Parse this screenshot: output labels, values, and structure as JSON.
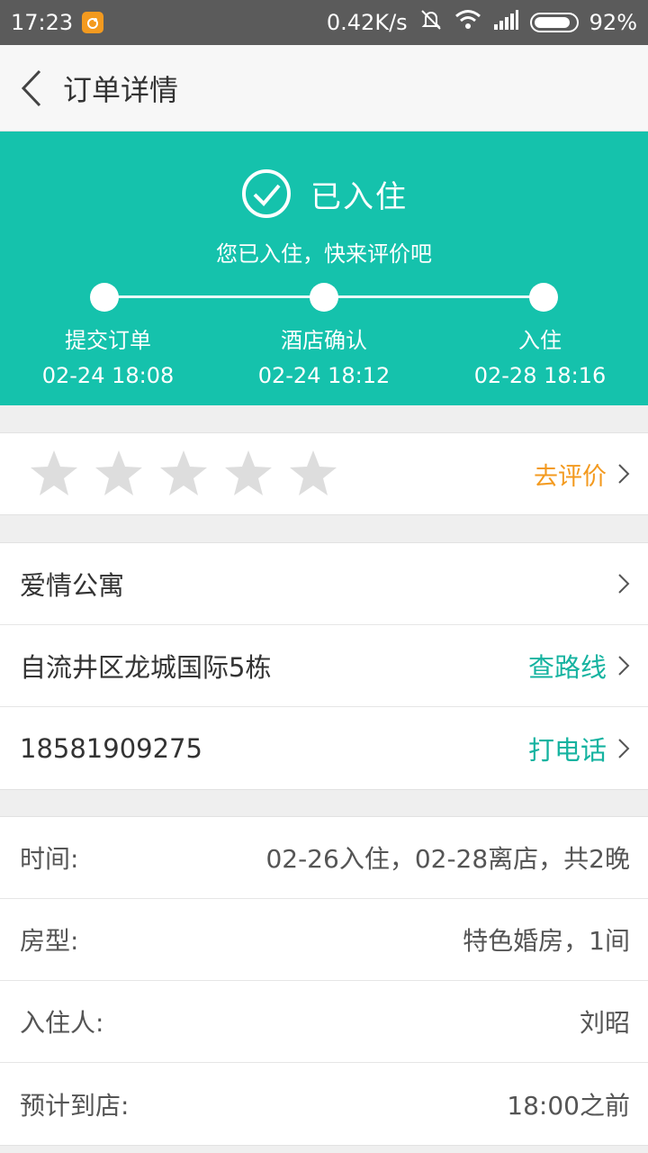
{
  "status_bar": {
    "time": "17:23",
    "network_speed": "0.42K/s",
    "battery": "92%",
    "icons": [
      "uc-browser-icon",
      "silent-icon",
      "wifi-icon",
      "signal-icon",
      "battery-icon"
    ]
  },
  "header": {
    "title": "订单详情"
  },
  "order_status": {
    "title": "已入住",
    "subtitle": "您已入住，快来评价吧",
    "steps": [
      {
        "label": "提交订单",
        "time": "02-24 18:08"
      },
      {
        "label": "酒店确认",
        "time": "02-24 18:12"
      },
      {
        "label": "入住",
        "time": "02-28 18:16"
      }
    ]
  },
  "rating": {
    "stars_total": 5,
    "stars_filled": 0,
    "action_label": "去评价"
  },
  "hotel": {
    "name": "爱情公寓",
    "address": "自流井区龙城国际5栋",
    "route_label": "查路线",
    "phone": "18581909275",
    "call_label": "打电话"
  },
  "details": [
    {
      "label": "时间:",
      "value": "02-26入住，02-28离店，共2晚"
    },
    {
      "label": "房型:",
      "value": "特色婚房，1间"
    },
    {
      "label": "入住人:",
      "value": "刘昭"
    },
    {
      "label": "预计到店:",
      "value": "18:00之前"
    }
  ],
  "colors": {
    "accent": "#15c2ac",
    "link_orange": "#f39a1f",
    "link_teal": "#15b3a0",
    "star_empty": "#dddddd"
  }
}
